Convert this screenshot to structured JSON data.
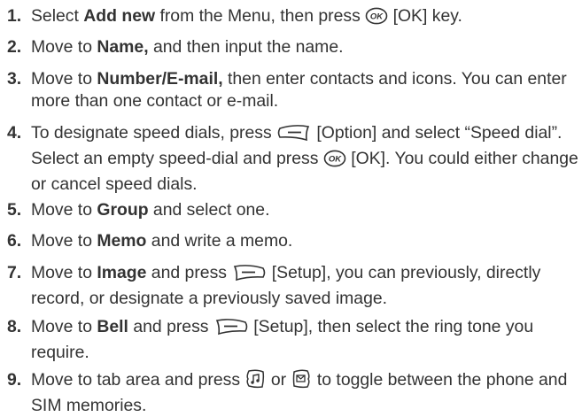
{
  "steps": [
    {
      "num": "1.",
      "a": "Select ",
      "b": "Add new",
      "c": " from the Menu, then press ",
      "d": " [OK] key."
    },
    {
      "num": "2.",
      "a": "Move to ",
      "b": "Name,",
      "c": " and then input the name."
    },
    {
      "num": "3.",
      "a": "Move to ",
      "b": "Number/E-mail,",
      "c": " then enter contacts and icons. You can enter more than one contact or e-mail."
    },
    {
      "num": "4.",
      "a": "To designate speed dials, press ",
      "b": " [Option] and select “Speed dial”. Select an empty speed-dial and press ",
      "c": " [OK]. You could either change or cancel speed dials."
    },
    {
      "num": "5.",
      "a": "Move to ",
      "b": "Group",
      "c": " and select one."
    },
    {
      "num": "6.",
      "a": "Move to ",
      "b": "Memo",
      "c": " and write a memo."
    },
    {
      "num": "7.",
      "a": "Move to ",
      "b": "Image",
      "c": " and press ",
      "d": " [Setup], you can previously, directly record, or designate a previously saved image."
    },
    {
      "num": "8.",
      "a": "Move to ",
      "b": "Bell",
      "c": " and press ",
      "d": " [Setup], then select the ring tone you require."
    },
    {
      "num": "9.",
      "a": "Move to tab area and press ",
      "b": " or ",
      "c": " to toggle between the phone and SIM memories."
    }
  ],
  "icons": {
    "ok_key": "ok-key-icon",
    "ok_key_label": "OK",
    "left_soft_key": "left-soft-key-icon",
    "right_soft_key": "right-soft-key-icon",
    "music_key": "music-key-icon",
    "message_key": "message-key-icon"
  }
}
